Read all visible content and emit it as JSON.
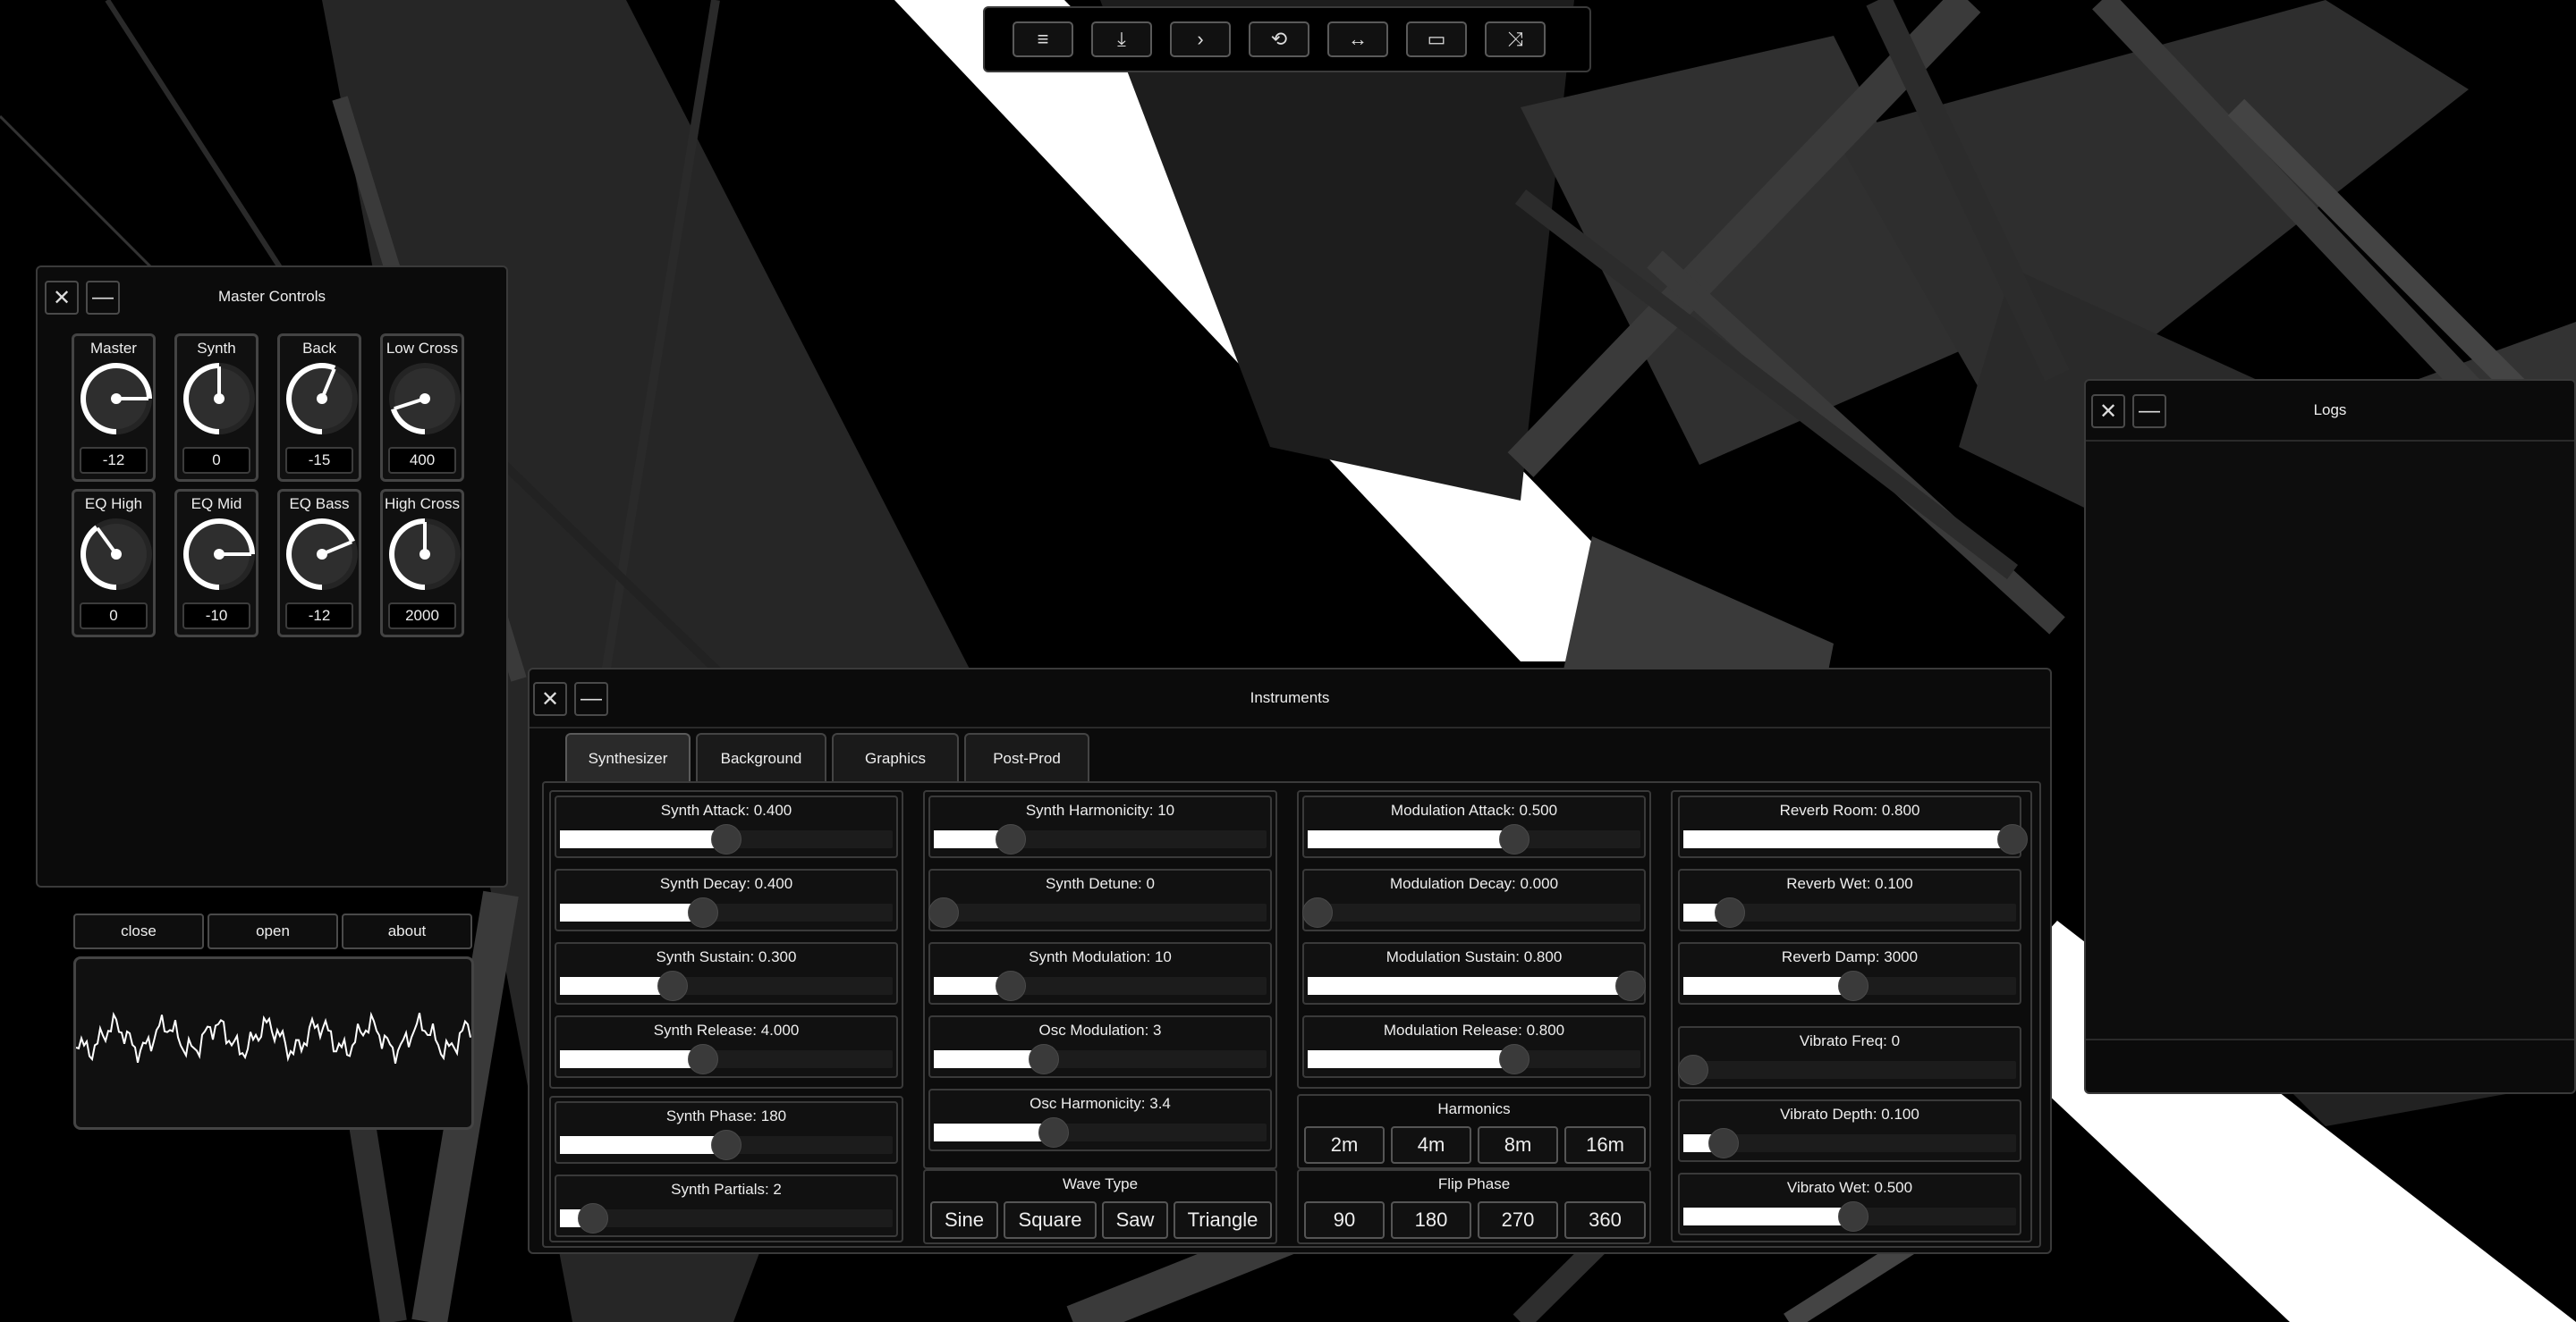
{
  "toolbar": {
    "buttons": [
      {
        "icon": "menu-icon",
        "glyph": "≡"
      },
      {
        "icon": "download-icon",
        "glyph": "⤓"
      },
      {
        "icon": "chevron-right-icon",
        "glyph": "›"
      },
      {
        "icon": "refresh-icon",
        "glyph": "⟲"
      },
      {
        "icon": "horizontal-arrows-icon",
        "glyph": "↔"
      },
      {
        "icon": "screen-icon",
        "glyph": "▭"
      },
      {
        "icon": "shuffle-icon",
        "glyph": "⤨"
      }
    ]
  },
  "master": {
    "title": "Master Controls",
    "close_glyph": "✕",
    "minimize_glyph": "—",
    "knobs": [
      {
        "label": "Master",
        "value": "-12",
        "level": 0.75
      },
      {
        "label": "Synth",
        "value": "0",
        "level": 0.5
      },
      {
        "label": "Back",
        "value": "-15",
        "level": 0.5625
      },
      {
        "label": "Low Cross",
        "value": "400",
        "level": 0.2
      },
      {
        "label": "EQ High",
        "value": "0",
        "level": 0.4
      },
      {
        "label": "EQ Mid",
        "value": "-10",
        "level": 0.75
      },
      {
        "label": "EQ Bass",
        "value": "-12",
        "level": 0.6875
      },
      {
        "label": "High Cross",
        "value": "2000",
        "level": 0.5
      }
    ],
    "buttons": {
      "close": "close",
      "open": "open",
      "about": "about"
    }
  },
  "logs": {
    "title": "Logs",
    "close_glyph": "✕",
    "minimize_glyph": "—"
  },
  "instruments": {
    "title": "Instruments",
    "close_glyph": "✕",
    "minimize_glyph": "—",
    "tabs": [
      "Synthesizer",
      "Background",
      "Graphics",
      "Post-Prod"
    ],
    "active_tab": "Synthesizer",
    "sliders": {
      "synth_attack": {
        "label": "Synth Attack:  0.400",
        "level": 0.5
      },
      "synth_decay": {
        "label": "Synth Decay:  0.400",
        "level": 0.43
      },
      "synth_sustain": {
        "label": "Synth Sustain:  0.300",
        "level": 0.34
      },
      "synth_release": {
        "label": "Synth Release:  4.000",
        "level": 0.43
      },
      "synth_phase": {
        "label": "Synth Phase:  180",
        "level": 0.5
      },
      "synth_partials": {
        "label": "Synth Partials:   2",
        "level": 0.1
      },
      "synth_harmonicity": {
        "label": "Synth Harmonicity: 10",
        "level": 0.23
      },
      "synth_detune": {
        "label": "Synth Detune: 0",
        "level": 0.03
      },
      "synth_modulation": {
        "label": "Synth Modulation:  10",
        "level": 0.23
      },
      "osc_modulation": {
        "label": "Osc Modulation: 3",
        "level": 0.33
      },
      "osc_harmonicity": {
        "label": "Osc Harmonicity: 3.4",
        "level": 0.36
      },
      "mod_attack": {
        "label": "Modulation Attack: 0.500",
        "level": 0.62
      },
      "mod_decay": {
        "label": "Modulation Decay: 0.000",
        "level": 0.03
      },
      "mod_sustain": {
        "label": "Modulation Sustain: 0.800",
        "level": 0.97
      },
      "mod_release": {
        "label": "Modulation Release: 0.800",
        "level": 0.62
      },
      "reverb_room": {
        "label": "Reverb Room: 0.800",
        "level": 0.99
      },
      "reverb_wet": {
        "label": "Reverb Wet:  0.100",
        "level": 0.14
      },
      "reverb_damp": {
        "label": "Reverb Damp: 3000",
        "level": 0.51
      },
      "vibrato_freq": {
        "label": "Vibrato Freq: 0",
        "level": 0.03
      },
      "vibrato_depth": {
        "label": "Vibrato Depth:  0.100",
        "level": 0.12
      },
      "vibrato_wet": {
        "label": "Vibrato Wet: 0.500",
        "level": 0.51
      }
    },
    "harmonics": {
      "title": "Harmonics",
      "options": [
        "2m",
        "4m",
        "8m",
        "16m"
      ]
    },
    "wave_type": {
      "title": "Wave Type",
      "options": [
        "Sine",
        "Square",
        "Saw",
        "Triangle"
      ]
    },
    "flip_phase": {
      "title": "Flip Phase",
      "options": [
        "90",
        "180",
        "270",
        "360"
      ]
    }
  }
}
